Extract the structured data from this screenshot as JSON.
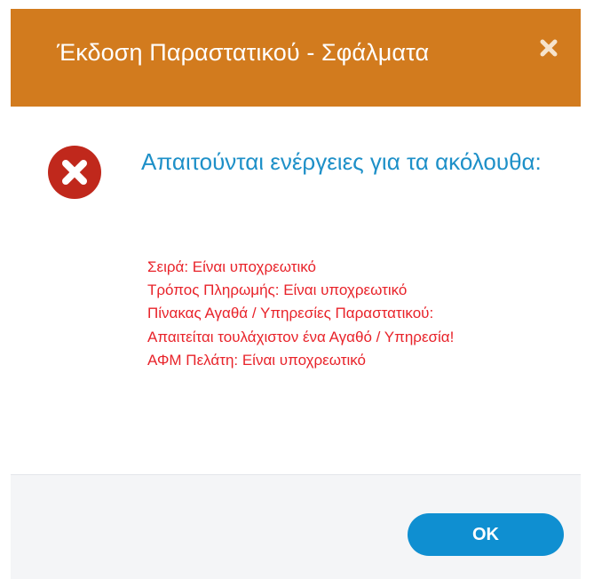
{
  "dialog": {
    "title": "Έκδοση Παραστατικού - Σφάλματα",
    "close_icon": "close-icon",
    "colors": {
      "titlebar": "#d27b1e",
      "heading": "#1e90c8",
      "error_text": "#e8232a",
      "ok_button": "#0f8fd1",
      "error_icon": "#c0281c"
    }
  },
  "content": {
    "status_icon": "error-icon",
    "heading": "Απαιτούνται ενέργειες για τα ακόλουθα:",
    "errors": [
      "Σειρά: Είναι υποχρεωτικό",
      "Τρόπος Πληρωμής: Είναι υποχρεωτικό",
      "Πίνακας Αγαθά / Υπηρεσίες Παραστατικού:",
      "Απαιτείται τουλάχιστον ένα Αγαθό / Υπηρεσία!",
      "ΑΦΜ Πελάτη: Είναι υποχρεωτικό"
    ]
  },
  "footer": {
    "ok_label": "OK"
  }
}
